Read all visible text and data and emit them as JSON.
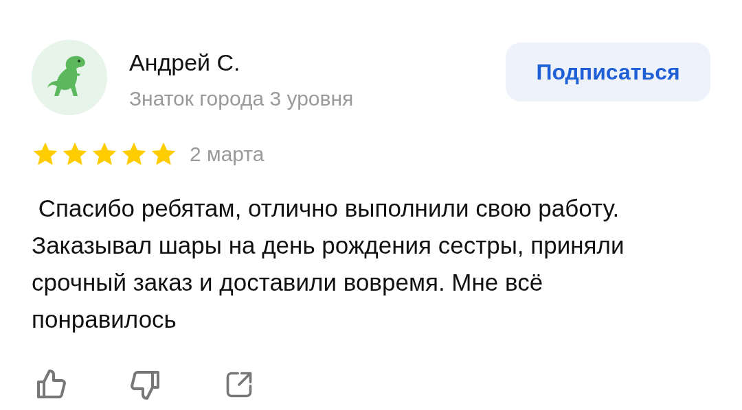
{
  "author": {
    "name": "Андрей С.",
    "level": "Знаток города 3 уровня"
  },
  "subscribe_button": "Подписаться",
  "review": {
    "stars": 5,
    "date": "2 марта",
    "text": " Спасибо ребятам, отлично выполнили свою работу. Заказывал шары на день рождения сестры, приняли срочный заказ и доставили вовремя. Мне всё понравилось"
  }
}
